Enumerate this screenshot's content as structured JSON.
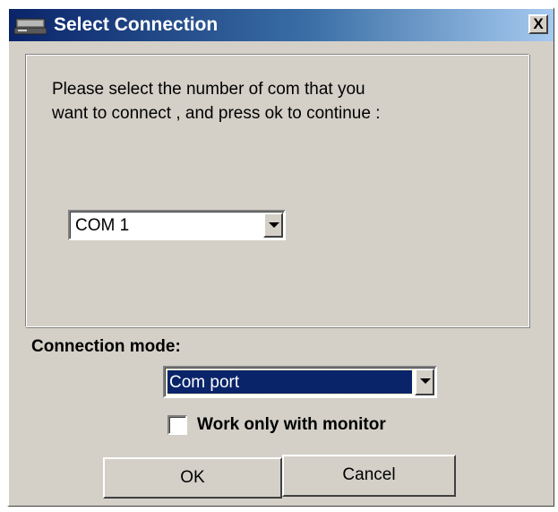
{
  "window": {
    "title": "Select Connection",
    "close_label": "X"
  },
  "prompt": {
    "line1": "Please select the number of com that you",
    "line2": "want to connect , and press ok to continue :"
  },
  "com_select": {
    "selected": "COM 1"
  },
  "connection_mode": {
    "label": "Connection mode:",
    "selected": "Com port"
  },
  "monitor_checkbox": {
    "label": "Work only with monitor",
    "checked": false
  },
  "buttons": {
    "ok": "OK",
    "cancel": "Cancel"
  },
  "icons": {
    "title": "computer-icon",
    "dropdown": "chevron-down-icon"
  },
  "colors": {
    "titlebar_start": "#0a246a",
    "titlebar_end": "#a6caf0",
    "window_bg": "#d4d0c8",
    "selection": "#0a246a"
  }
}
